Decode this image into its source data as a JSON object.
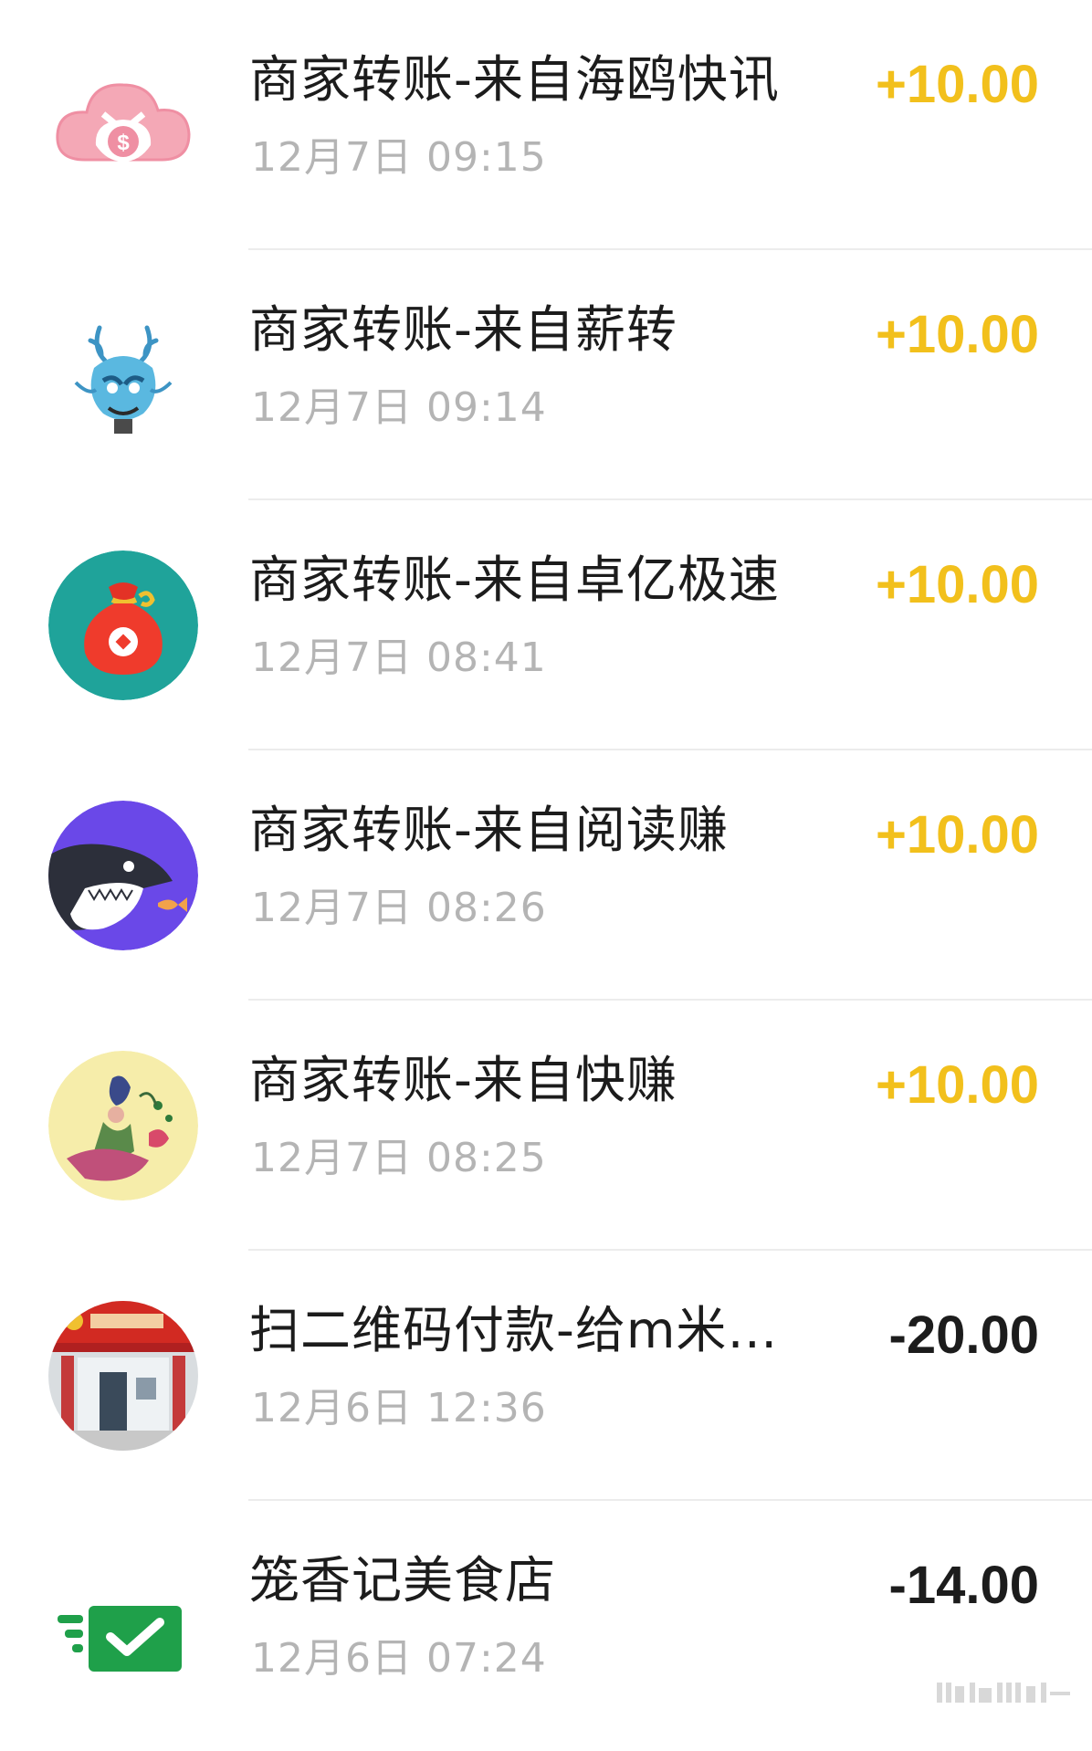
{
  "transactions": [
    {
      "title": "商家转账-来自海鸥快讯",
      "time": "12月7日 09:15",
      "amount": "+10.00",
      "type": "income",
      "avatar": "cloud-money-icon"
    },
    {
      "title": "商家转账-来自薪转",
      "time": "12月7日 09:14",
      "amount": "+10.00",
      "type": "income",
      "avatar": "dragon-avatar"
    },
    {
      "title": "商家转账-来自卓亿极速",
      "time": "12月7日 08:41",
      "amount": "+10.00",
      "type": "income",
      "avatar": "money-bag-icon"
    },
    {
      "title": "商家转账-来自阅读赚",
      "time": "12月7日 08:26",
      "amount": "+10.00",
      "type": "income",
      "avatar": "shark-avatar"
    },
    {
      "title": "商家转账-来自快赚",
      "time": "12月7日 08:25",
      "amount": "+10.00",
      "type": "income",
      "avatar": "flower-art-avatar"
    },
    {
      "title": "扫二维码付款-给m米…",
      "time": "12月6日 12:36",
      "amount": "-20.00",
      "type": "expense",
      "avatar": "storefront-avatar"
    },
    {
      "title": "笼香记美食店",
      "time": "12月6日 07:24",
      "amount": "-14.00",
      "type": "expense",
      "avatar": "payment-check-icon"
    }
  ],
  "colors": {
    "income": "#f2c01c",
    "expense": "#1c1c1c",
    "time": "#b4b4b4"
  }
}
